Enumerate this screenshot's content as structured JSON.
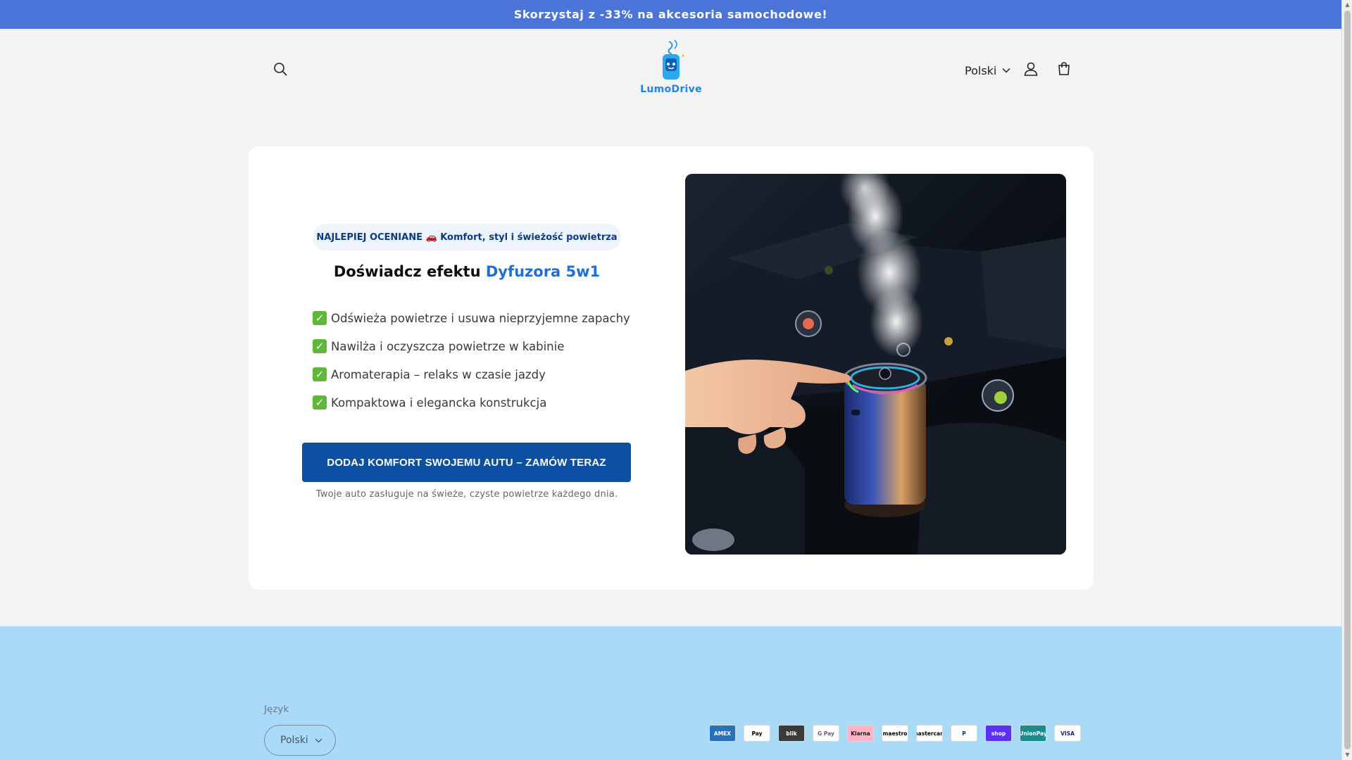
{
  "announcement": {
    "text": "Skorzystaj z -33% na akcesoria samochodowe!"
  },
  "header": {
    "logo_text": "LumoDrive",
    "language_label": "Polski"
  },
  "hero": {
    "badge_text": "NAJLEPIEJ OCENIANE 🚗 Komfort, styl i świeżość powietrza",
    "headline_prefix": "Doświadcz efektu",
    "headline_accent": "Dyfuzora 5w1",
    "features": [
      "Odświeża powietrze i usuwa nieprzyjemne zapachy",
      "Nawilża i oczyszcza powietrze w kabinie",
      "Aromaterapia – relaks w czasie jazdy",
      "Kompaktowa i elegancka konstrukcja"
    ],
    "cta_label": "DODAJ KOMFORT SWOJEMU AUTU – ZAMÓW TERAZ",
    "cta_subtext": "Twoje auto zasługuje na świeże, czyste powietrze każdego dnia."
  },
  "footer": {
    "language_heading": "Język",
    "language_value": "Polski",
    "payment_methods": [
      {
        "name": "American Express",
        "label": "AMEX",
        "color": "#2671b9",
        "text_color": "#ffffff"
      },
      {
        "name": "Apple Pay",
        "label": "Pay",
        "color": "#ffffff",
        "text_color": "#000000"
      },
      {
        "name": "BLIK",
        "label": "blik",
        "color": "#3a3a3a",
        "text_color": "#ffffff"
      },
      {
        "name": "Google Pay",
        "label": "G Pay",
        "color": "#ffffff",
        "text_color": "#5f6368"
      },
      {
        "name": "Klarna",
        "label": "Klarna",
        "color": "#ffb3c7",
        "text_color": "#17120f"
      },
      {
        "name": "Maestro",
        "label": "maestro",
        "color": "#ffffff",
        "text_color": "#000000"
      },
      {
        "name": "Mastercard",
        "label": "mastercard",
        "color": "#ffffff",
        "text_color": "#000000"
      },
      {
        "name": "PayPal",
        "label": "P",
        "color": "#ffffff",
        "text_color": "#003087"
      },
      {
        "name": "Shop Pay",
        "label": "shop",
        "color": "#5a31f4",
        "text_color": "#ffffff"
      },
      {
        "name": "UnionPay",
        "label": "UnionPay",
        "color": "#1a8c8c",
        "text_color": "#ffffff"
      },
      {
        "name": "Visa",
        "label": "VISA",
        "color": "#ffffff",
        "text_color": "#1a1f71"
      }
    ]
  },
  "colors": {
    "announcement_bg": "#4a74d8",
    "cta_bg": "#0d4fa3",
    "accent": "#1f6fd4",
    "footer_bg": "#a9daf7"
  }
}
